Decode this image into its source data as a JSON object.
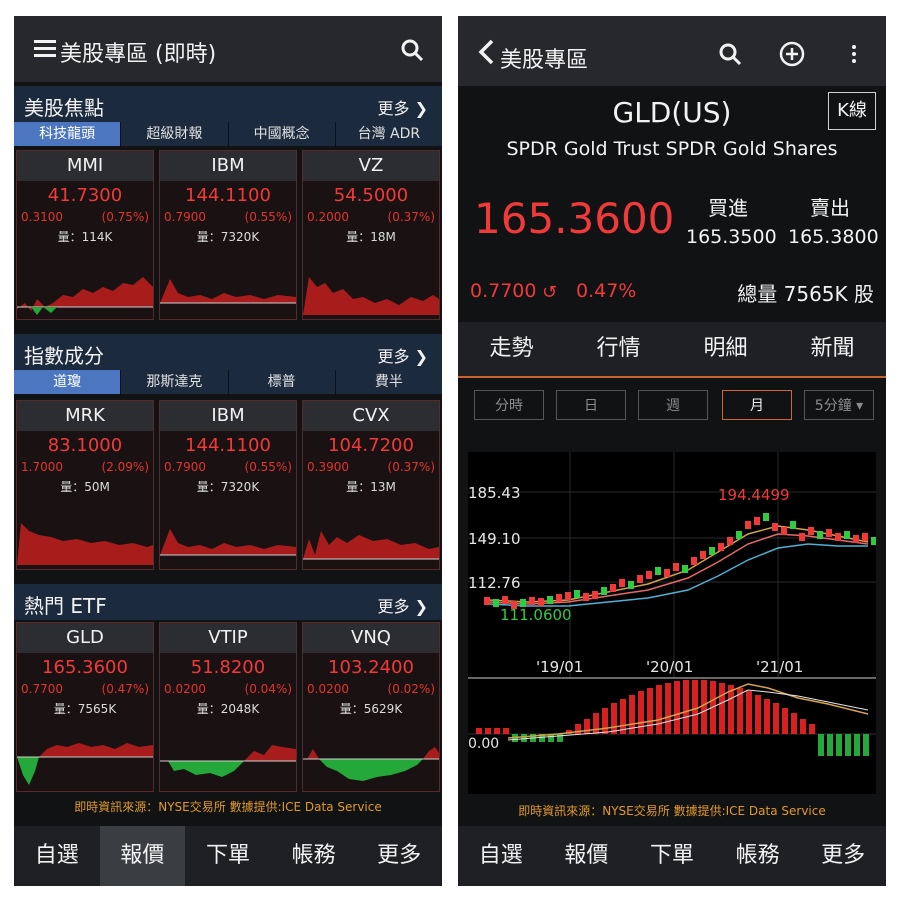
{
  "left": {
    "header": {
      "title": "美股專區 (即時)"
    },
    "sections": [
      {
        "title": "美股焦點",
        "more": "更多",
        "tabs": [
          "科技龍頭",
          "超級財報",
          "中國概念",
          "台灣 ADR"
        ],
        "active_tab": 0,
        "cards": [
          {
            "name": "MMI",
            "price": "41.7300",
            "change": "0.3100",
            "pct": "(0.75%)",
            "volume": "量：114K"
          },
          {
            "name": "IBM",
            "price": "144.1100",
            "change": "0.7900",
            "pct": "(0.55%)",
            "volume": "量：7320K"
          },
          {
            "name": "VZ",
            "price": "54.5000",
            "change": "0.2000",
            "pct": "(0.37%)",
            "volume": "量：18M"
          }
        ]
      },
      {
        "title": "指數成分",
        "more": "更多",
        "tabs": [
          "道瓊",
          "那斯達克",
          "標普",
          "費半"
        ],
        "active_tab": 0,
        "cards": [
          {
            "name": "MRK",
            "price": "83.1000",
            "change": "1.7000",
            "pct": "(2.09%)",
            "volume": "量：50M"
          },
          {
            "name": "IBM",
            "price": "144.1100",
            "change": "0.7900",
            "pct": "(0.55%)",
            "volume": "量：7320K"
          },
          {
            "name": "CVX",
            "price": "104.7200",
            "change": "0.3900",
            "pct": "(0.37%)",
            "volume": "量：13M"
          }
        ]
      },
      {
        "title": "熱門 ETF",
        "more": "更多",
        "tabs": [],
        "cards": [
          {
            "name": "GLD",
            "price": "165.3600",
            "change": "0.7700",
            "pct": "(0.47%)",
            "volume": "量：7565K"
          },
          {
            "name": "VTIP",
            "price": "51.8200",
            "change": "0.0200",
            "pct": "(0.04%)",
            "volume": "量：2048K"
          },
          {
            "name": "VNQ",
            "price": "103.2400",
            "change": "0.0200",
            "pct": "(0.02%)",
            "volume": "量：5629K"
          }
        ]
      }
    ],
    "source": "即時資訊來源：NYSE交易所 數據提供:ICE Data Service",
    "nav": [
      "自選",
      "報價",
      "下單",
      "帳務",
      "更多"
    ],
    "nav_selected": 1
  },
  "right": {
    "header": {
      "back_title": "美股專區"
    },
    "symbol": "GLD(US)",
    "kline_label": "K線",
    "fullname": "SPDR Gold Trust SPDR Gold Shares",
    "price": "165.3600",
    "bid_label": "買進",
    "ask_label": "賣出",
    "bid": "165.3500",
    "ask": "165.3800",
    "change": "0.7700",
    "change_pct": "0.47%",
    "volume": "總量 7565K 股",
    "tabs": [
      "走勢",
      "行情",
      "明細",
      "新聞"
    ],
    "periods": [
      "分時",
      "日",
      "週",
      "月",
      "5分鐘"
    ],
    "active_period": 3,
    "source": "即時資訊來源：NYSE交易所 數據提供:ICE Data Service",
    "nav": [
      "自選",
      "報價",
      "下單",
      "帳務",
      "更多"
    ]
  },
  "colors": {
    "up": "#f03a3a",
    "down": "#2ecc40",
    "accent": "#d06a2a",
    "tab_active": "#4c77c0"
  },
  "chart_data": {
    "type": "candlestick",
    "y_labels": [
      "185.43",
      "149.10",
      "112.76"
    ],
    "x_labels": [
      "'19/01",
      "'20/01",
      "'21/01"
    ],
    "max_label": "194.4499",
    "min_label": "111.0600",
    "indicator_zero_label": "0.00"
  }
}
